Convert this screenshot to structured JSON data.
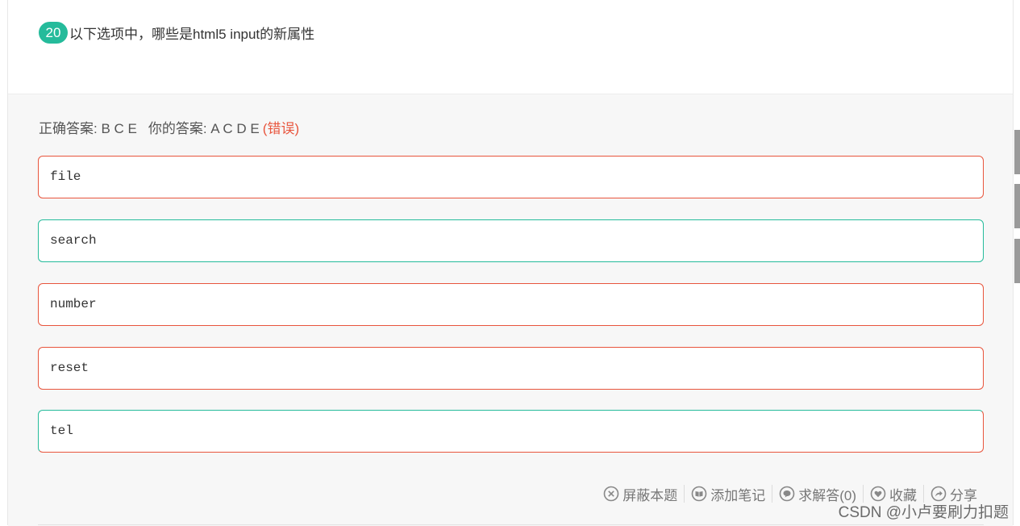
{
  "question": {
    "number": "20",
    "text": "以下选项中，哪些是html5 input的新属性"
  },
  "result": {
    "correct_label": "正确答案: B C E",
    "your_label": "你的答案: A C D E",
    "status": "(错误)"
  },
  "options": [
    {
      "text": "file",
      "state": "wrong"
    },
    {
      "text": "search",
      "state": "correct"
    },
    {
      "text": "number",
      "state": "wrong"
    },
    {
      "text": "reset",
      "state": "wrong"
    },
    {
      "text": "tel",
      "state": "correct"
    }
  ],
  "toolbar": {
    "block": "屏蔽本题",
    "note": "添加笔记",
    "ask": "求解答(0)",
    "collect": "收藏",
    "share": "分享"
  },
  "icons": {
    "block": "close-circle-icon",
    "note": "book-icon",
    "ask": "chat-bubble-icon",
    "collect": "heart-icon",
    "share": "share-icon"
  },
  "colors": {
    "accent_green": "#25bb9b",
    "error_red": "#e8553d"
  },
  "watermark": "CSDN @小卢要刷力扣题"
}
